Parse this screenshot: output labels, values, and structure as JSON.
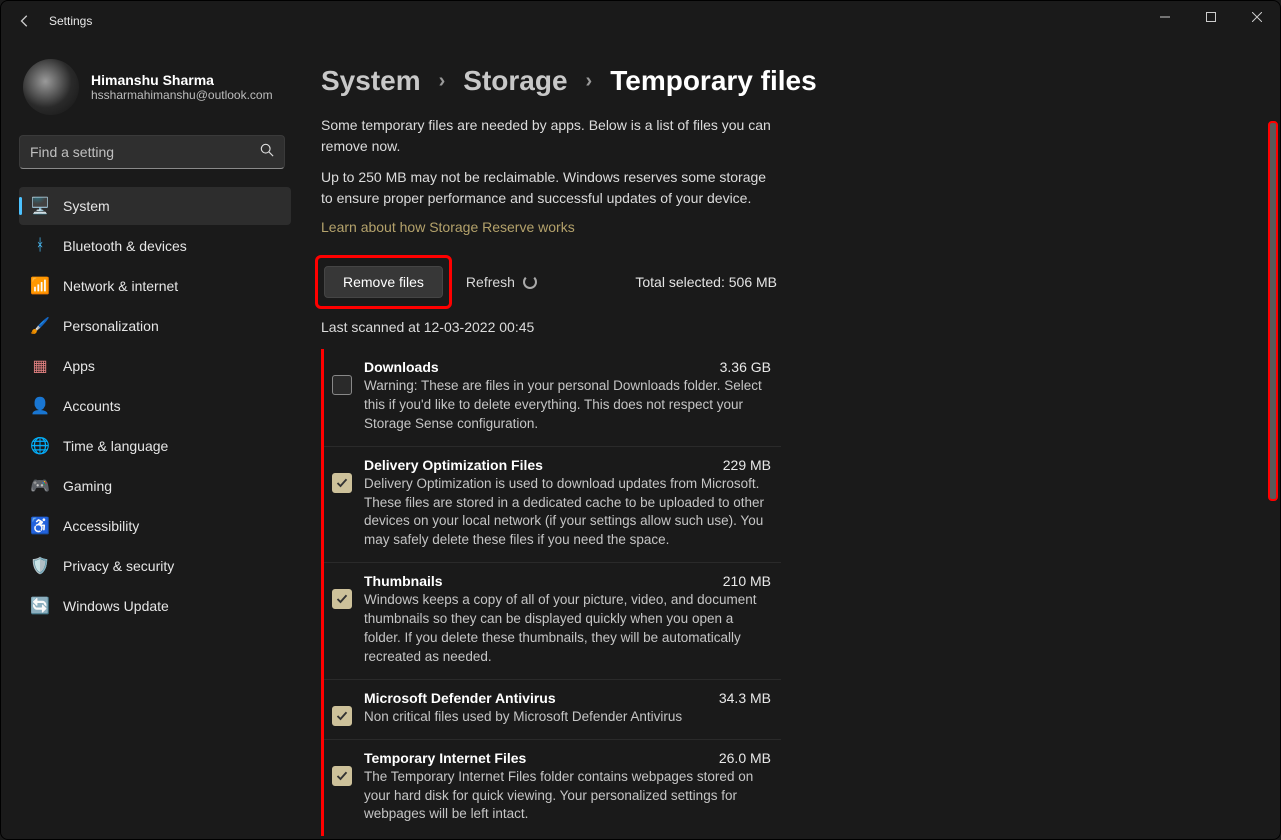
{
  "window": {
    "title": "Settings"
  },
  "user": {
    "name": "Himanshu Sharma",
    "email": "hssharmahimanshu@outlook.com"
  },
  "search": {
    "placeholder": "Find a setting"
  },
  "sidebar": {
    "items": [
      {
        "label": "System",
        "icon": "🖥️",
        "active": true
      },
      {
        "label": "Bluetooth & devices",
        "icon": "ᚼ",
        "color": "#4cc2ff"
      },
      {
        "label": "Network & internet",
        "icon": "📶",
        "color": "#4cc2ff"
      },
      {
        "label": "Personalization",
        "icon": "🖌️"
      },
      {
        "label": "Apps",
        "icon": "▦",
        "color": "#e08080"
      },
      {
        "label": "Accounts",
        "icon": "👤",
        "color": "#7ec99b"
      },
      {
        "label": "Time & language",
        "icon": "🌐",
        "color": "#b4a26b"
      },
      {
        "label": "Gaming",
        "icon": "🎮",
        "color": "#8ab060"
      },
      {
        "label": "Accessibility",
        "icon": "♿",
        "color": "#6fa8d6"
      },
      {
        "label": "Privacy & security",
        "icon": "🛡️",
        "color": "#9aa0a6"
      },
      {
        "label": "Windows Update",
        "icon": "🔄",
        "color": "#4cc2ff"
      }
    ]
  },
  "breadcrumb": {
    "items": [
      "System",
      "Storage",
      "Temporary files"
    ]
  },
  "intro": {
    "desc1": "Some temporary files are needed by apps. Below is a list of files you can remove now.",
    "desc2": "Up to 250 MB may not be reclaimable. Windows reserves some storage to ensure proper performance and successful updates of your device.",
    "link": "Learn about how Storage Reserve works"
  },
  "actions": {
    "remove": "Remove files",
    "refresh": "Refresh",
    "total_label": "Total selected:",
    "total_value": "506 MB",
    "scanned": "Last scanned at 12-03-2022 00:45"
  },
  "files": [
    {
      "title": "Downloads",
      "size": "3.36 GB",
      "checked": false,
      "desc": "Warning: These are files in your personal Downloads folder. Select this if you'd like to delete everything. This does not respect your Storage Sense configuration."
    },
    {
      "title": "Delivery Optimization Files",
      "size": "229 MB",
      "checked": true,
      "desc": "Delivery Optimization is used to download updates from Microsoft. These files are stored in a dedicated cache to be uploaded to other devices on your local network (if your settings allow such use). You may safely delete these files if you need the space."
    },
    {
      "title": "Thumbnails",
      "size": "210 MB",
      "checked": true,
      "desc": "Windows keeps a copy of all of your picture, video, and document thumbnails so they can be displayed quickly when you open a folder. If you delete these thumbnails, they will be automatically recreated as needed."
    },
    {
      "title": "Microsoft Defender Antivirus",
      "size": "34.3 MB",
      "checked": true,
      "desc": "Non critical files used by Microsoft Defender Antivirus"
    },
    {
      "title": "Temporary Internet Files",
      "size": "26.0 MB",
      "checked": true,
      "desc": "The Temporary Internet Files folder contains webpages stored on your hard disk for quick viewing. Your personalized settings for webpages will be left intact."
    }
  ]
}
